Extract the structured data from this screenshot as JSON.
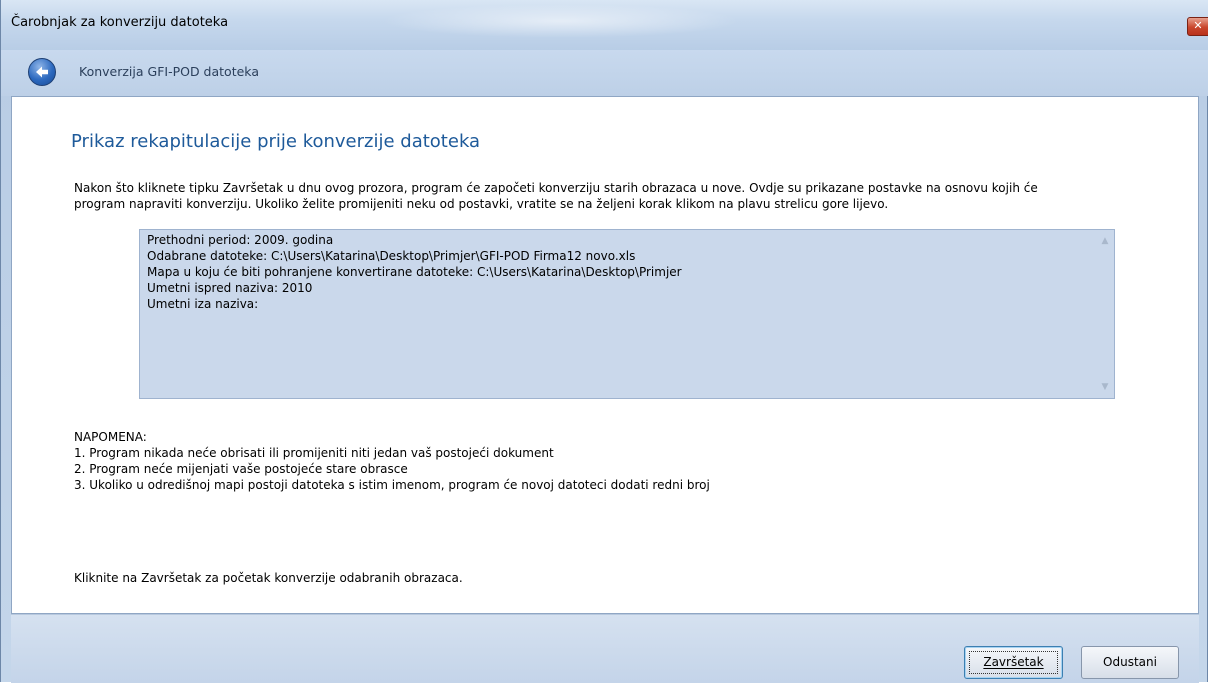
{
  "window": {
    "title": "Čarobnjak za konverziju datoteka",
    "close_label": "✕"
  },
  "nav": {
    "title": "Konverzija GFI-POD datoteka"
  },
  "main": {
    "heading": "Prikaz rekapitulacije prije konverzije datoteka",
    "intro_line1": "Nakon što kliknete tipku Završetak u dnu ovog prozora, program će započeti konverziju starih obrazaca u nove. Ovdje su prikazane postavke na osnovu kojih će",
    "intro_line2": "program napraviti konverziju. Ukoliko želite promijeniti neku od postavki, vratite se na željeni korak klikom na plavu strelicu gore lijevo.",
    "summary": [
      "Prethodni period: 2009. godina",
      "Odabrane datoteke: C:\\Users\\Katarina\\Desktop\\Primjer\\GFI-POD Firma12 novo.xls",
      "Mapa u koju će biti pohranjene konvertirane datoteke: C:\\Users\\Katarina\\Desktop\\Primjer",
      "Umetni ispred naziva: 2010",
      "Umetni iza naziva:"
    ],
    "note_title": "NAPOMENA:",
    "notes": [
      "1. Program nikada neće obrisati ili promijeniti niti jedan vaš postojeći dokument",
      "2. Program neće mijenjati vaše postojeće stare obrasce",
      "3. Ukoliko u odredišnoj mapi postoji datoteka s istim imenom, program će novoj datoteci dodati redni broj"
    ],
    "finish_hint": "Kliknite na Završetak za početak konverzije odabranih obrazaca."
  },
  "footer": {
    "finish_label": "Završetak",
    "cancel_label": "Odustani"
  },
  "icons": {
    "back": "back-arrow-icon",
    "close": "close-icon",
    "scroll_up": "scroll-up-icon",
    "scroll_down": "scroll-down-icon"
  }
}
